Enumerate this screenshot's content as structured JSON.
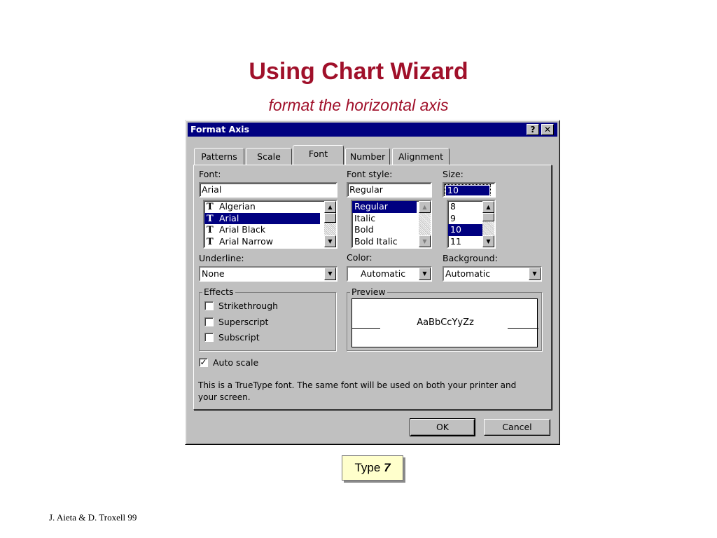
{
  "slide": {
    "title": "Using Chart Wizard",
    "subtitle": "format the horizontal axis",
    "footer": "J. Aieta & D. Troxell  99"
  },
  "callout": {
    "prefix": "Type ",
    "value": "7"
  },
  "dialog": {
    "title": "Format Axis",
    "help_glyph": "?",
    "close_glyph": "✕",
    "tabs": [
      {
        "label": "Patterns",
        "active": false
      },
      {
        "label": "Scale",
        "active": false
      },
      {
        "label": "Font",
        "active": true
      },
      {
        "label": "Number",
        "active": false
      },
      {
        "label": "Alignment",
        "active": false
      }
    ],
    "font": {
      "label": "Font:",
      "value": "Arial",
      "items": [
        "Algerian",
        "Arial",
        "Arial Black",
        "Arial Narrow"
      ],
      "selected": "Arial"
    },
    "font_style": {
      "label": "Font style:",
      "value": "Regular",
      "items": [
        "Regular",
        "Italic",
        "Bold",
        "Bold Italic"
      ],
      "selected": "Regular"
    },
    "size": {
      "label": "Size:",
      "value": "10",
      "items": [
        "8",
        "9",
        "10",
        "11"
      ],
      "selected": "10"
    },
    "underline": {
      "label": "Underline:",
      "value": "None"
    },
    "color": {
      "label": "Color:",
      "value": "Automatic"
    },
    "background": {
      "label": "Background:",
      "value": "Automatic"
    },
    "effects": {
      "label": "Effects",
      "strikethrough": {
        "label": "Strikethrough",
        "checked": false
      },
      "superscript": {
        "label": "Superscript",
        "checked": false
      },
      "subscript": {
        "label": "Subscript",
        "checked": false
      }
    },
    "preview": {
      "label": "Preview",
      "sample": "AaBbCcYyZz"
    },
    "auto_scale": {
      "label": "Auto scale",
      "checked": true
    },
    "info_line1": "This is a TrueType font.  The same font will be used on both your printer and",
    "info_line2": "your screen.",
    "ok_label": "OK",
    "cancel_label": "Cancel",
    "check_glyph": "✓",
    "colors": {
      "titlebar": "#000080",
      "face": "#c0c0c0",
      "title_text": "#a0102a",
      "callout_bg": "#ffffcc"
    }
  }
}
